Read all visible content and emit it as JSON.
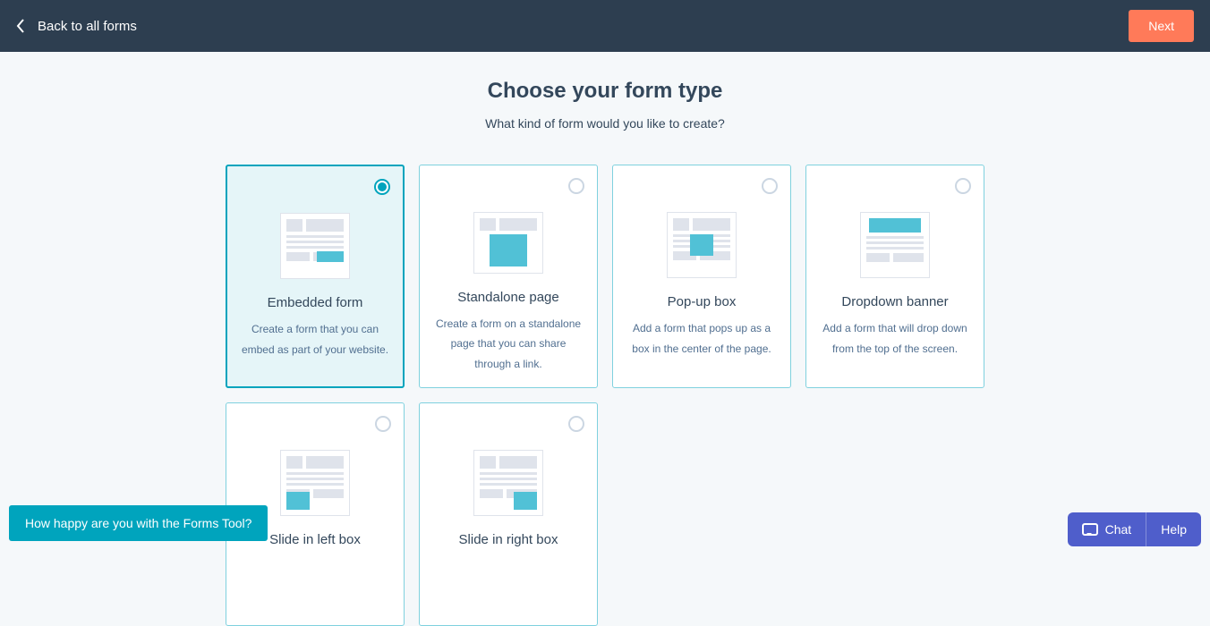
{
  "header": {
    "back_label": "Back to all forms",
    "next_label": "Next"
  },
  "page": {
    "title": "Choose your form type",
    "subtitle": "What kind of form would you like to create?"
  },
  "cards": [
    {
      "title": "Embedded form",
      "desc": "Create a form that you can embed as part of your website.",
      "selected": true
    },
    {
      "title": "Standalone page",
      "desc": "Create a form on a standalone page that you can share through a link.",
      "selected": false
    },
    {
      "title": "Pop-up box",
      "desc": "Add a form that pops up as a box in the center of the page.",
      "selected": false
    },
    {
      "title": "Dropdown banner",
      "desc": "Add a form that will drop down from the top of the screen.",
      "selected": false
    },
    {
      "title": "Slide in left box",
      "desc": "",
      "selected": false
    },
    {
      "title": "Slide in right box",
      "desc": "",
      "selected": false
    }
  ],
  "survey_prompt": "How happy are you with the Forms Tool?",
  "widgets": {
    "chat_label": "Chat",
    "help_label": "Help"
  },
  "colors": {
    "accent": "#00a4bd",
    "primary_btn": "#ff7a59",
    "header_bg": "#2d3e50",
    "widget_bg": "#4f5ecb"
  }
}
